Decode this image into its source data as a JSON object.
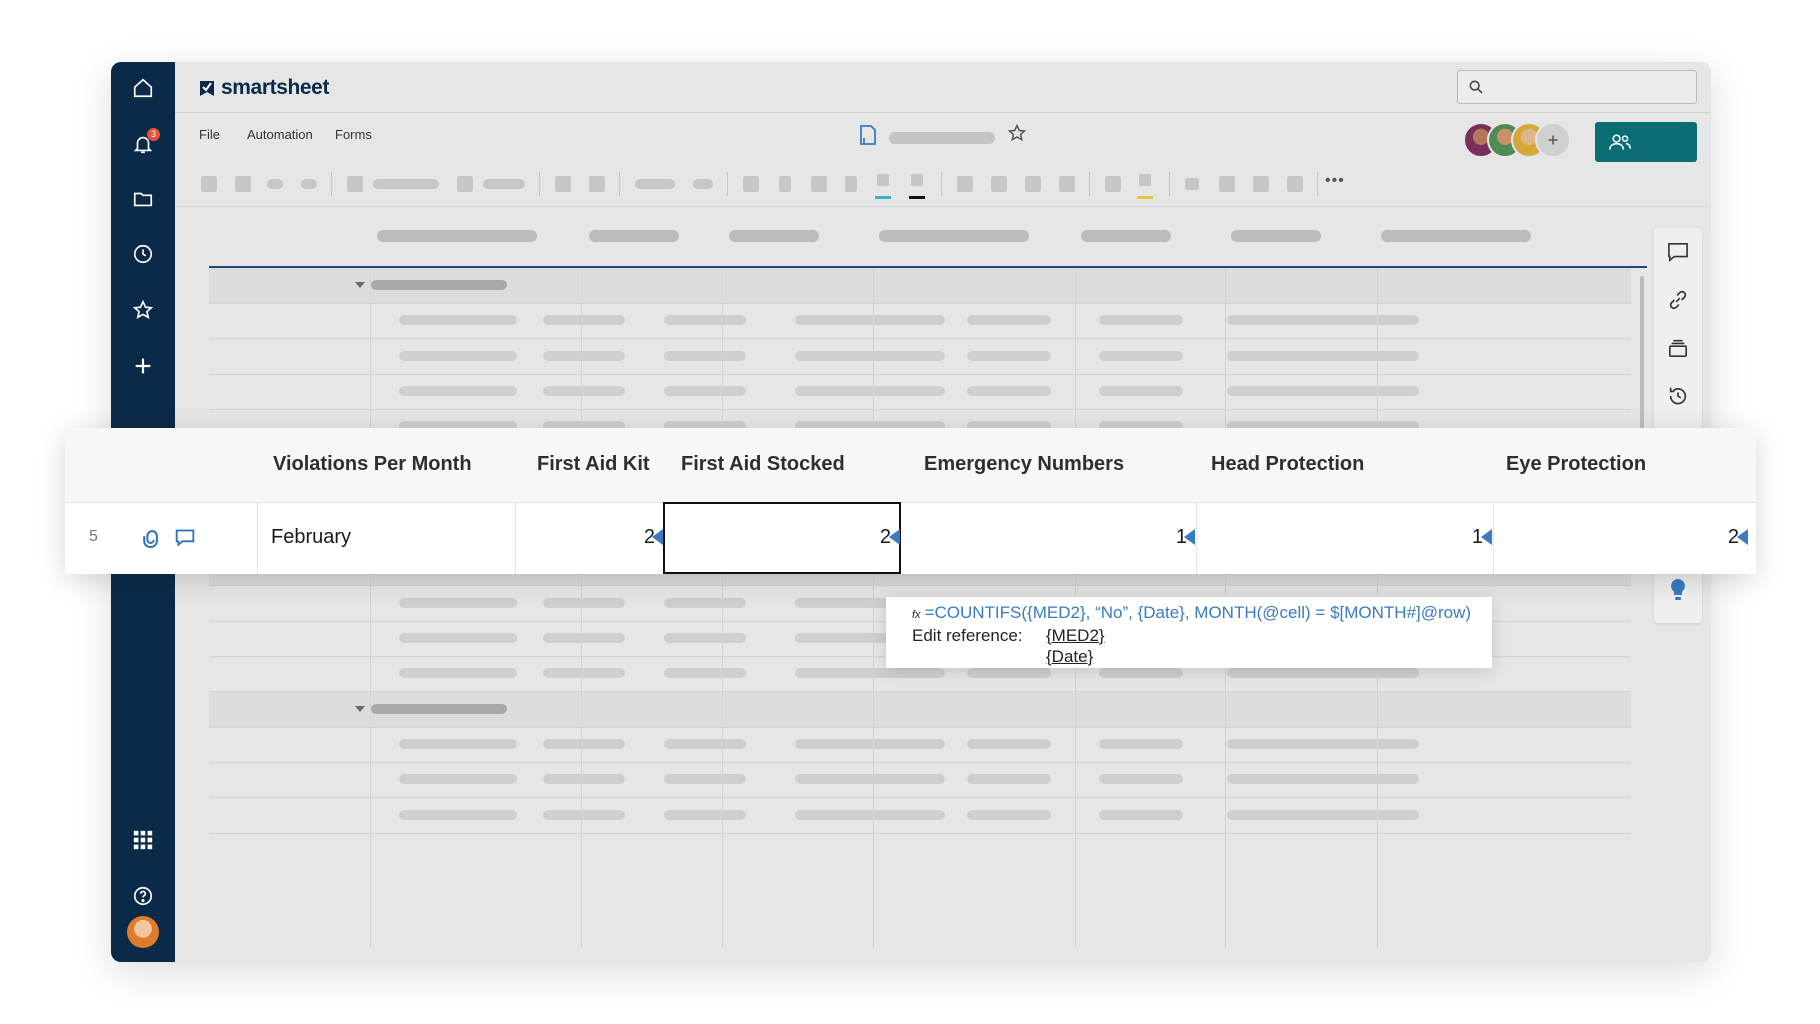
{
  "app": {
    "logo_text": "smartsheet",
    "notification_count": "3"
  },
  "nav_icons": [
    "home-icon",
    "bell-icon",
    "folder-icon",
    "clock-icon",
    "star-icon",
    "plus-icon",
    "apps-grid-icon",
    "help-icon"
  ],
  "menu": {
    "file": "File",
    "automation": "Automation",
    "forms": "Forms"
  },
  "colors": {
    "nav": "#0b2a4a",
    "share": "#0a6d74",
    "accent": "#3a7ac2",
    "teal_line": "#3ab3c8",
    "yellow_line": "#e8c53a"
  },
  "zoom": {
    "headers": [
      "Violations Per Month",
      "First Aid Kit",
      "First Aid Stocked",
      "Emergency Numbers",
      "Head Protection",
      "Eye Protection"
    ],
    "row": {
      "number": "5",
      "month": "February",
      "values": [
        "2",
        "2",
        "1",
        "1",
        "2"
      ]
    }
  },
  "tooltip": {
    "fx": "fx",
    "formula": "=COUNTIFS({MED2}, “No”, {Date}, MONTH(@cell) = $[MONTH#]@row)",
    "edit_label": "Edit reference:",
    "ref1": "{MED2}",
    "ref2": "{Date}"
  }
}
